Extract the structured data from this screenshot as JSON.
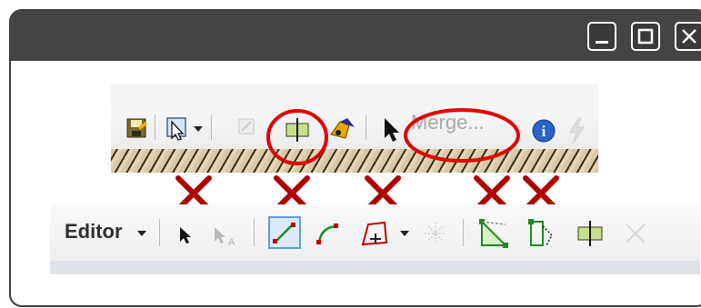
{
  "window": {
    "controls": {
      "minimize": "minimize-icon",
      "maximize": "maximize-icon",
      "close": "close-icon"
    }
  },
  "upper_toolbar": {
    "merge_label": "Merge...",
    "icons": [
      "save-edits-icon",
      "edit-annotation-icon",
      "dropdown-arrow-icon",
      "disabled-tool-icon",
      "split-tool-icon",
      "sketch-properties-icon",
      "select-arrow-icon",
      "info-icon",
      "lightning-icon"
    ]
  },
  "lower_toolbar": {
    "editor_label": "Editor",
    "icons": [
      "edit-tool-icon",
      "annotation-edit-icon",
      "straight-segment-icon",
      "endpoint-arc-icon",
      "trace-tool-icon",
      "midpoint-tool-icon",
      "reshape-feature-icon",
      "cut-polygons-icon",
      "split-tool-icon",
      "rotate-tool-icon"
    ]
  },
  "annotations": {
    "circle_color": "#e00000",
    "x_mark_color": "#b00000",
    "x_mark_count": 5
  }
}
